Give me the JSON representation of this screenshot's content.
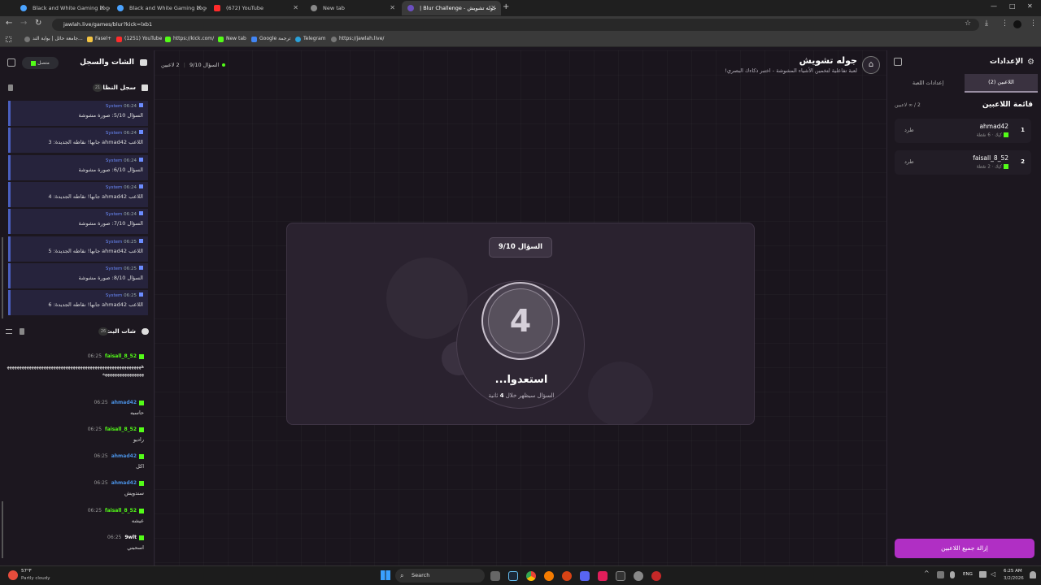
{
  "browser": {
    "tabs": [
      {
        "label": "Black and White Gaming Logo"
      },
      {
        "label": "Black and White Gaming Logo"
      },
      {
        "label": "(672) YouTube"
      },
      {
        "label": "New tab"
      },
      {
        "label": "| Blur Challenge - جوله تشويش"
      }
    ],
    "url": "jawlah.live/games/blur?kick=lxb1",
    "bookmarks": [
      {
        "label": "جامعة حائل | بوابة الند..."
      },
      {
        "label": "Fasel+"
      },
      {
        "label": "(1251) YouTube"
      },
      {
        "label": "https://kick.com/"
      },
      {
        "label": "New tab"
      },
      {
        "label": "Google ترجمة"
      },
      {
        "label": "Telegram"
      },
      {
        "label": "https://jawlah.live/"
      }
    ]
  },
  "left_panel": {
    "title": "الشات والسجل",
    "status": "متصل",
    "system_log": {
      "title": "سجل النظام",
      "count": "21",
      "entries": [
        {
          "sender": "System",
          "time": "06:24",
          "text": "السؤال 5/10: صورة مشوشة"
        },
        {
          "sender": "System",
          "time": "06:24",
          "text": "اللاعب ahmad42 جابها! نقاطه الجديدة: 3"
        },
        {
          "sender": "System",
          "time": "06:24",
          "text": "السؤال 6/10: صورة مشوشة"
        },
        {
          "sender": "System",
          "time": "06:24",
          "text": "اللاعب ahmad42 جابها! نقاطه الجديدة: 4"
        },
        {
          "sender": "System",
          "time": "06:24",
          "text": "السؤال 7/10: صورة مشوشة"
        },
        {
          "sender": "System",
          "time": "06:25",
          "text": "اللاعب ahmad42 جابها! نقاطه الجديدة: 5"
        },
        {
          "sender": "System",
          "time": "06:25",
          "text": "السؤال 8/10: صورة مشوشة"
        },
        {
          "sender": "System",
          "time": "06:25",
          "text": "اللاعب ahmad42 جابها! نقاطه الجديدة: 6"
        }
      ]
    },
    "live_chat": {
      "title": "شات البث",
      "count": "26",
      "messages": [
        {
          "user": "faisall_8_52",
          "time": "06:25",
          "text": "ههههههههههههههههههههههههههههههههههههههههههههههههههههههههههههههههههههههههه",
          "color": "#53fc18"
        },
        {
          "user": "ahmad42",
          "time": "06:25",
          "text": "حاسبه",
          "color": "#4a90e2"
        },
        {
          "user": "faisall_8_52",
          "time": "06:25",
          "text": "راديو",
          "color": "#53fc18"
        },
        {
          "user": "ahmad42",
          "time": "06:25",
          "text": "اكل",
          "color": "#4a90e2"
        },
        {
          "user": "ahmad42",
          "time": "06:25",
          "text": "سندويش",
          "color": "#4a90e2"
        },
        {
          "user": "faisall_8_52",
          "time": "06:25",
          "text": "عيشه",
          "color": "#53fc18"
        },
        {
          "user": "9wlt",
          "time": "06:25",
          "text": "اسحبني",
          "color": "#ffffff"
        }
      ]
    }
  },
  "header": {
    "title": "جوله تشويش",
    "subtitle": "لعبة تفاعلية لتخمين الأشياء المشوشة - اختبر ذكاءك البصري!",
    "players": "2 لاعبين",
    "question": "السؤال 9/10"
  },
  "game_card": {
    "question_badge": "السؤال 9/10",
    "countdown": "4",
    "heading": "استعدوا...",
    "sub_prefix": "السؤال سيظهر خلال",
    "sub_number": "4",
    "sub_suffix": "ثانية"
  },
  "right_panel": {
    "title": "الإعدادات",
    "tabs": [
      "اللاعبين (2)",
      "إعدادات اللعبة"
    ],
    "players_heading": "قائمة اللاعبين",
    "players_count": "2 / ∞ لاعبين",
    "players": [
      {
        "rank": "1",
        "name": "ahmad42",
        "meta": "كيك · 6 نقطة",
        "kick_label": "طرد"
      },
      {
        "rank": "2",
        "name": "faisall_8_52",
        "meta": "كيك · 2 نقطة",
        "kick_label": "طرد"
      }
    ],
    "remove_all": "إزالة جميع اللاعبين"
  },
  "taskbar": {
    "weather_temp": "57°F",
    "weather_desc": "Partly cloudy",
    "search": "Search",
    "lang": "ENG",
    "time": "6:25 AM",
    "date": "3/2/2026"
  }
}
